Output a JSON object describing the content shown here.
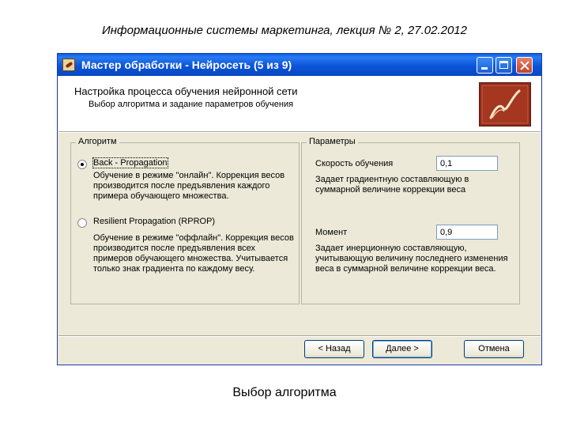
{
  "slide": {
    "title": "Информационные системы маркетинга, лекция № 2, 27.02.2012",
    "caption": "Выбор алгоритма"
  },
  "window": {
    "title": "Мастер обработки - Нейросеть (5 из 9)",
    "header_title": "Настройка процесса обучения нейронной сети",
    "header_subtitle": "Выбор алгоритма и задание параметров обучения"
  },
  "algorithm": {
    "group_label": "Алгоритм",
    "options": [
      {
        "label": "Back - Propagation",
        "selected": true,
        "description": "Обучение в режиме \"онлайн\". Коррекция весов производится после предъявления каждого примера обучающего множества."
      },
      {
        "label": "Resilient Propagation (RPROP)",
        "selected": false,
        "description": "Обучение в режиме \"оффлайн\". Коррекция весов производится после предъявления всех примеров обучающего множества. Учитывается только знак градиента по каждому весу."
      }
    ]
  },
  "parameters": {
    "group_label": "Параметры",
    "learning_rate": {
      "label": "Скорость обучения",
      "value": "0,1",
      "description": "Задает градиентную составляющую в суммарной величине коррекции веса"
    },
    "momentum": {
      "label": "Момент",
      "value": "0,9",
      "description": "Задает инерционную составляющую, учитывающую величину последнего изменения веса в суммарной величине коррекции веса."
    }
  },
  "buttons": {
    "back": "< Назад",
    "next": "Далее >",
    "cancel": "Отмена"
  },
  "colors": {
    "titlebar": "#0b55d9",
    "dialog_bg": "#ece9d8",
    "logo_bg": "#8e2a1a"
  }
}
